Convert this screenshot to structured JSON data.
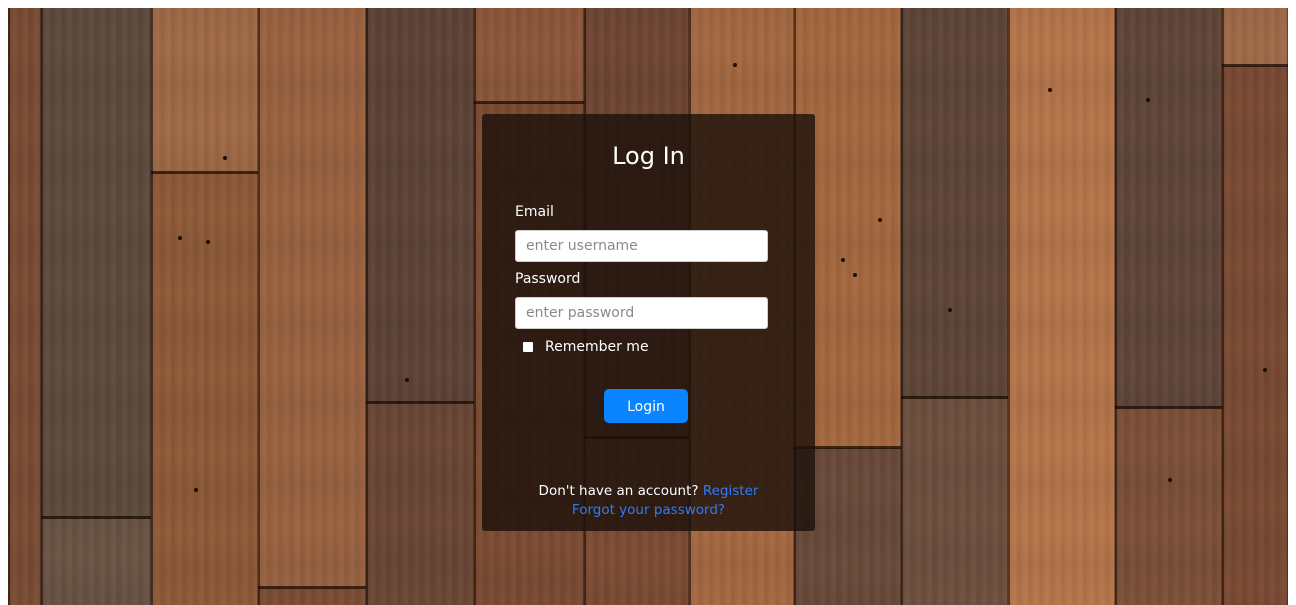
{
  "login": {
    "title": "Log In",
    "email_label": "Email",
    "email_placeholder": "enter username",
    "email_value": "",
    "password_label": "Password",
    "password_placeholder": "enter password",
    "password_value": "",
    "remember_label": "Remember me",
    "remember_checked": false,
    "login_button": "Login",
    "no_account_text": "Don't have an account?",
    "register_link": "Register",
    "forgot_link": "Forgot your password?"
  },
  "colors": {
    "card_background": "#1c100a",
    "button_blue": "#0a84ff",
    "link_blue": "#2f7cf6",
    "wood_background": "#6e4a33"
  }
}
